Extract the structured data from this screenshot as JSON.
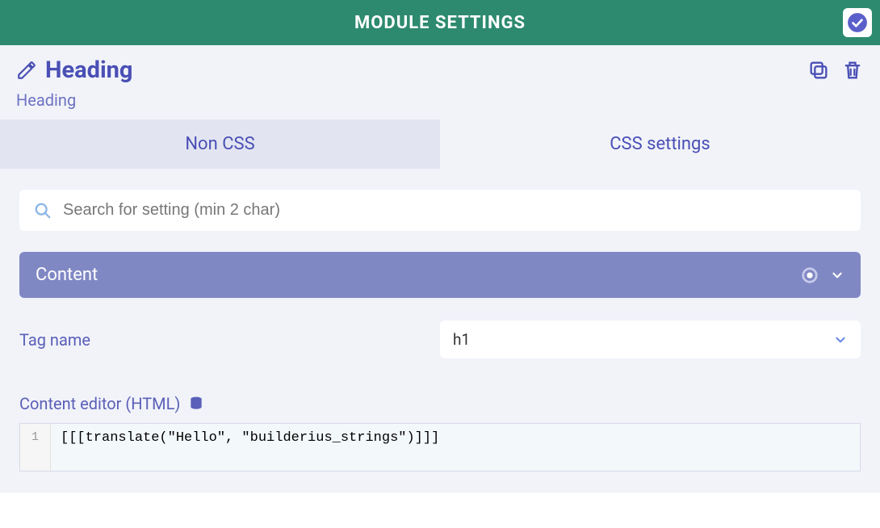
{
  "header": {
    "title": "MODULE SETTINGS"
  },
  "module": {
    "title": "Heading",
    "subtitle": "Heading"
  },
  "tabs": {
    "nonCss": "Non CSS",
    "css": "CSS settings"
  },
  "search": {
    "placeholder": "Search for setting (min 2 char)"
  },
  "section": {
    "content": "Content"
  },
  "fields": {
    "tagName": {
      "label": "Tag name",
      "value": "h1"
    },
    "contentEditor": {
      "label": "Content editor (HTML)"
    }
  },
  "code": {
    "lineNumber": "1",
    "line1": "[[[translate(\"Hello\", \"builderius_strings\")]]]"
  }
}
